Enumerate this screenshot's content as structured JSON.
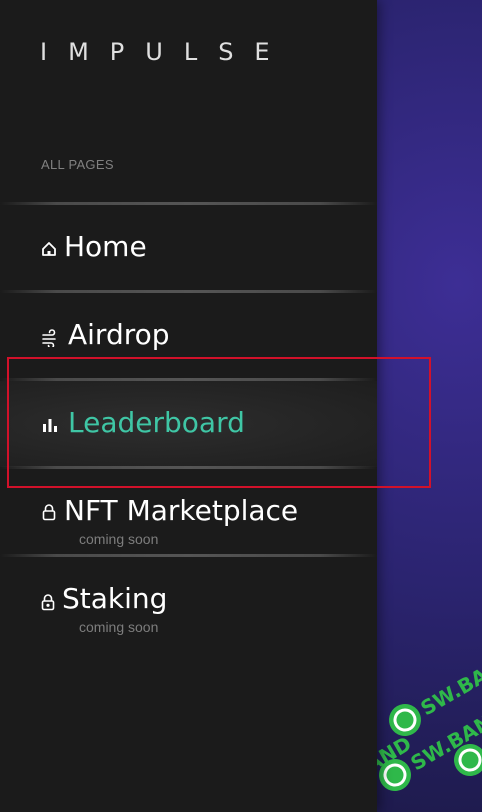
{
  "brand": {
    "logo_text": "IMPULSE"
  },
  "menu": {
    "section_label": "ALL PAGES",
    "items": [
      {
        "label": "Home",
        "icon": "home-icon",
        "sublabel": "",
        "active": false
      },
      {
        "label": "Airdrop",
        "icon": "wind-icon",
        "sublabel": "",
        "active": false
      },
      {
        "label": "Leaderboard",
        "icon": "bar-chart-icon",
        "sublabel": "",
        "active": true
      },
      {
        "label": "NFT Marketplace",
        "icon": "lock-icon",
        "sublabel": "coming soon",
        "active": false
      },
      {
        "label": "Staking",
        "icon": "lock-icon",
        "sublabel": "coming soon",
        "active": false
      }
    ]
  },
  "watermark": {
    "text": "SW.BAND"
  },
  "colors": {
    "drawer_bg": "#1b1b1b",
    "active_text": "#3fc6a5",
    "highlight_border": "#d2112a",
    "backdrop": "#2b2470",
    "watermark_green": "#2fb84a"
  }
}
